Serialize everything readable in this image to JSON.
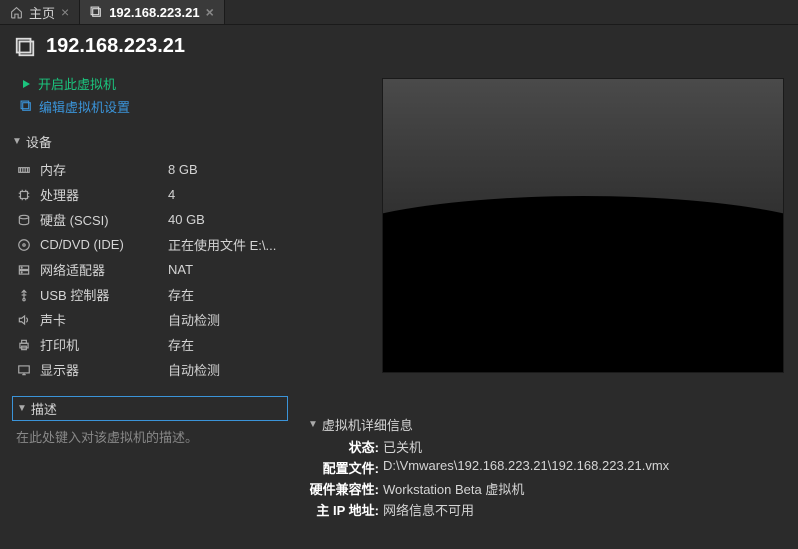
{
  "tabs": [
    {
      "label": "主页",
      "active": false
    },
    {
      "label": "192.168.223.21",
      "active": true
    }
  ],
  "title": "192.168.223.21",
  "actions": {
    "power_on": "开启此虚拟机",
    "edit_settings": "编辑虚拟机设置"
  },
  "device_section": "设备",
  "devices": [
    {
      "icon": "memory-icon",
      "name": "内存",
      "value": "8 GB"
    },
    {
      "icon": "cpu-icon",
      "name": "处理器",
      "value": "4"
    },
    {
      "icon": "disk-icon",
      "name": "硬盘 (SCSI)",
      "value": "40 GB"
    },
    {
      "icon": "cd-icon",
      "name": "CD/DVD (IDE)",
      "value": "正在使用文件 E:\\..."
    },
    {
      "icon": "network-icon",
      "name": "网络适配器",
      "value": "NAT"
    },
    {
      "icon": "usb-icon",
      "name": "USB 控制器",
      "value": "存在"
    },
    {
      "icon": "sound-icon",
      "name": "声卡",
      "value": "自动检测"
    },
    {
      "icon": "printer-icon",
      "name": "打印机",
      "value": "存在"
    },
    {
      "icon": "display-icon",
      "name": "显示器",
      "value": "自动检测"
    }
  ],
  "description_section": "描述",
  "description_placeholder": "在此处键入对该虚拟机的描述。",
  "details_section": "虚拟机详细信息",
  "details": {
    "state_label": "状态:",
    "state_value": "已关机",
    "config_label": "配置文件:",
    "config_value": "D:\\Vmwares\\192.168.223.21\\192.168.223.21.vmx",
    "compat_label": "硬件兼容性:",
    "compat_value": "Workstation Beta 虚拟机",
    "ip_label": "主 IP 地址:",
    "ip_value": "网络信息不可用"
  }
}
